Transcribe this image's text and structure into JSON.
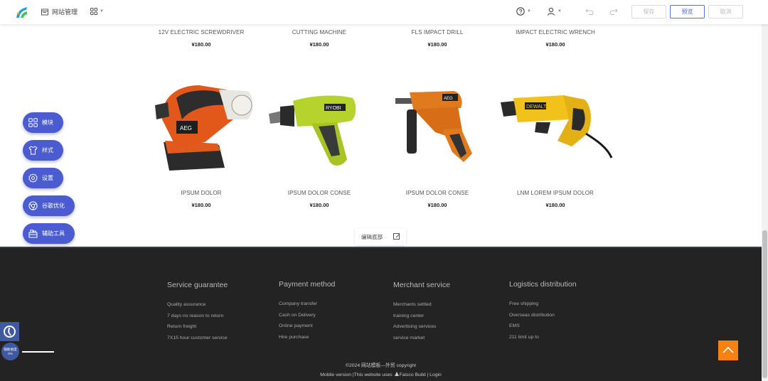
{
  "topbar": {
    "site_management": "网站管理",
    "save": "保存",
    "preview": "预览",
    "cancel": "取消"
  },
  "products_top": [
    {
      "name": "12V ELECTRIC SCREWDRIVER",
      "price": "¥180.00"
    },
    {
      "name": "CUTTING MACHINE",
      "price": "¥180.00"
    },
    {
      "name": "FLS IMPACT DRILL",
      "price": "¥180.00"
    },
    {
      "name": "IMPACT ELECTRIC WRENCH",
      "price": "¥180.00"
    }
  ],
  "products_bottom": [
    {
      "name": "IPSUM DOLOR",
      "price": "¥180.00",
      "image": "orbital-sander-icon"
    },
    {
      "name": "IPSUM DOLOR CONSE",
      "price": "¥180.00",
      "image": "cordless-drill-icon"
    },
    {
      "name": "IPSUM DOLOR CONSE",
      "price": "¥180.00",
      "image": "hammer-drill-icon"
    },
    {
      "name": "LNM LOREM IPSUM DOLOR",
      "price": "¥180.00",
      "image": "reciprocating-saw-icon"
    }
  ],
  "edit_footer": "编辑底部",
  "side_menu": [
    "模块",
    "样式",
    "设置",
    "谷歌优化",
    "辅助工具"
  ],
  "footer": {
    "columns": [
      {
        "title": "Service guarantee",
        "items": [
          "Quality assurance",
          "7 days no reason to return",
          "Return freight",
          "7X15 hour customer service"
        ]
      },
      {
        "title": "Payment method",
        "items": [
          "Company transfer",
          "Cash on Delivery",
          "Online payment",
          "Hire purchase"
        ]
      },
      {
        "title": "Merchant service",
        "items": [
          "Merchants settled",
          "training center",
          "Advertising services",
          "service market"
        ]
      },
      {
        "title": "Logistics distribution",
        "items": [
          "Free shipping",
          "Overseas distribution",
          "EMS",
          "211 limit up to"
        ]
      }
    ],
    "copyright": "©2024 网站模板—外贸 copyright",
    "mobile_line_a": "Mobile version |This website uses ",
    "brand": "Faisco",
    "mobile_line_b": " Build | Login"
  },
  "assist_widget": {
    "label": "辅助进度",
    "percent": "0%"
  },
  "colors": {
    "accent": "#4a5cd0",
    "footer_bg": "#232323",
    "to_top": "#f68211"
  }
}
